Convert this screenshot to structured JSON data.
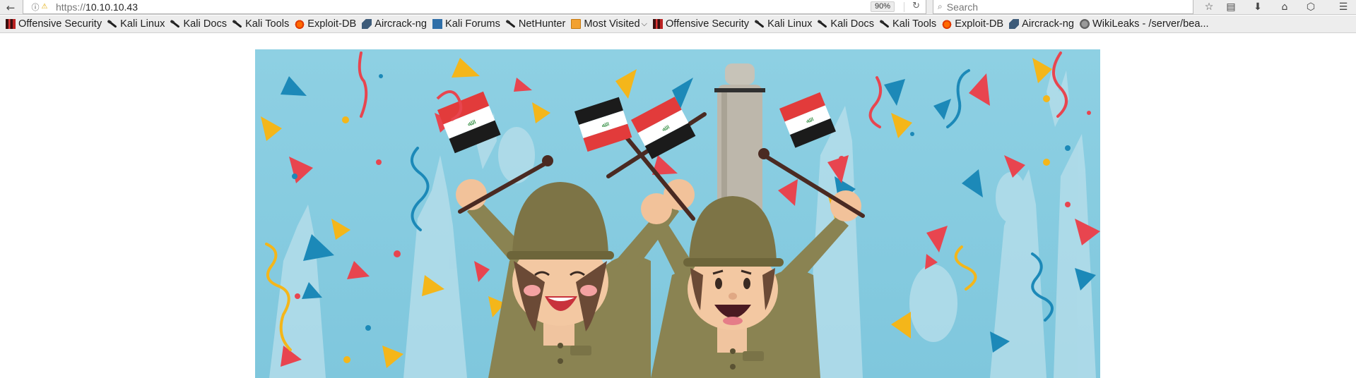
{
  "browser": {
    "url_prefix": "https://",
    "url_host": "10.10.10.43",
    "zoom": "90%",
    "search_placeholder": "Search"
  },
  "icons": {
    "back": "back-arrow-icon",
    "info": "info-icon",
    "insecure": "insecure-lock-icon",
    "reload": "reload-icon",
    "search": "search-icon",
    "bookmark_star": "star-icon",
    "reader": "clipboard-icon",
    "download": "download-icon",
    "home": "home-icon",
    "pocket": "pocket-icon",
    "menu": "hamburger-menu-icon"
  },
  "bookmarks": [
    {
      "label": "Offensive Security",
      "icon": "offsec"
    },
    {
      "label": "Kali Linux",
      "icon": "kali"
    },
    {
      "label": "Kali Docs",
      "icon": "kali"
    },
    {
      "label": "Kali Tools",
      "icon": "kali"
    },
    {
      "label": "Exploit-DB",
      "icon": "edb"
    },
    {
      "label": "Aircrack-ng",
      "icon": "air"
    },
    {
      "label": "Kali Forums",
      "icon": "forum"
    },
    {
      "label": "NetHunter",
      "icon": "kali"
    },
    {
      "label": "Most Visited",
      "icon": "folder"
    },
    {
      "label": "Offensive Security",
      "icon": "offsec"
    },
    {
      "label": "Kali Linux",
      "icon": "kali"
    },
    {
      "label": "Kali Docs",
      "icon": "kali"
    },
    {
      "label": "Kali Tools",
      "icon": "kali"
    },
    {
      "label": "Exploit-DB",
      "icon": "edb"
    },
    {
      "label": "Aircrack-ng",
      "icon": "air"
    },
    {
      "label": "WikiLeaks - /server/bea...",
      "icon": "wiki"
    }
  ],
  "page": {
    "image": "celebrating-soldiers-illustration"
  },
  "colors": {
    "sky": "#86cde0",
    "uniform": "#8a8352",
    "helmet": "#7d7446",
    "flag_red": "#e23b3b",
    "flag_black": "#1b1b1b",
    "flag_green": "#2e8b3e",
    "confetti_yellow": "#f4b61a",
    "confetti_red": "#e8454f",
    "confetti_blue": "#1c89b8"
  }
}
